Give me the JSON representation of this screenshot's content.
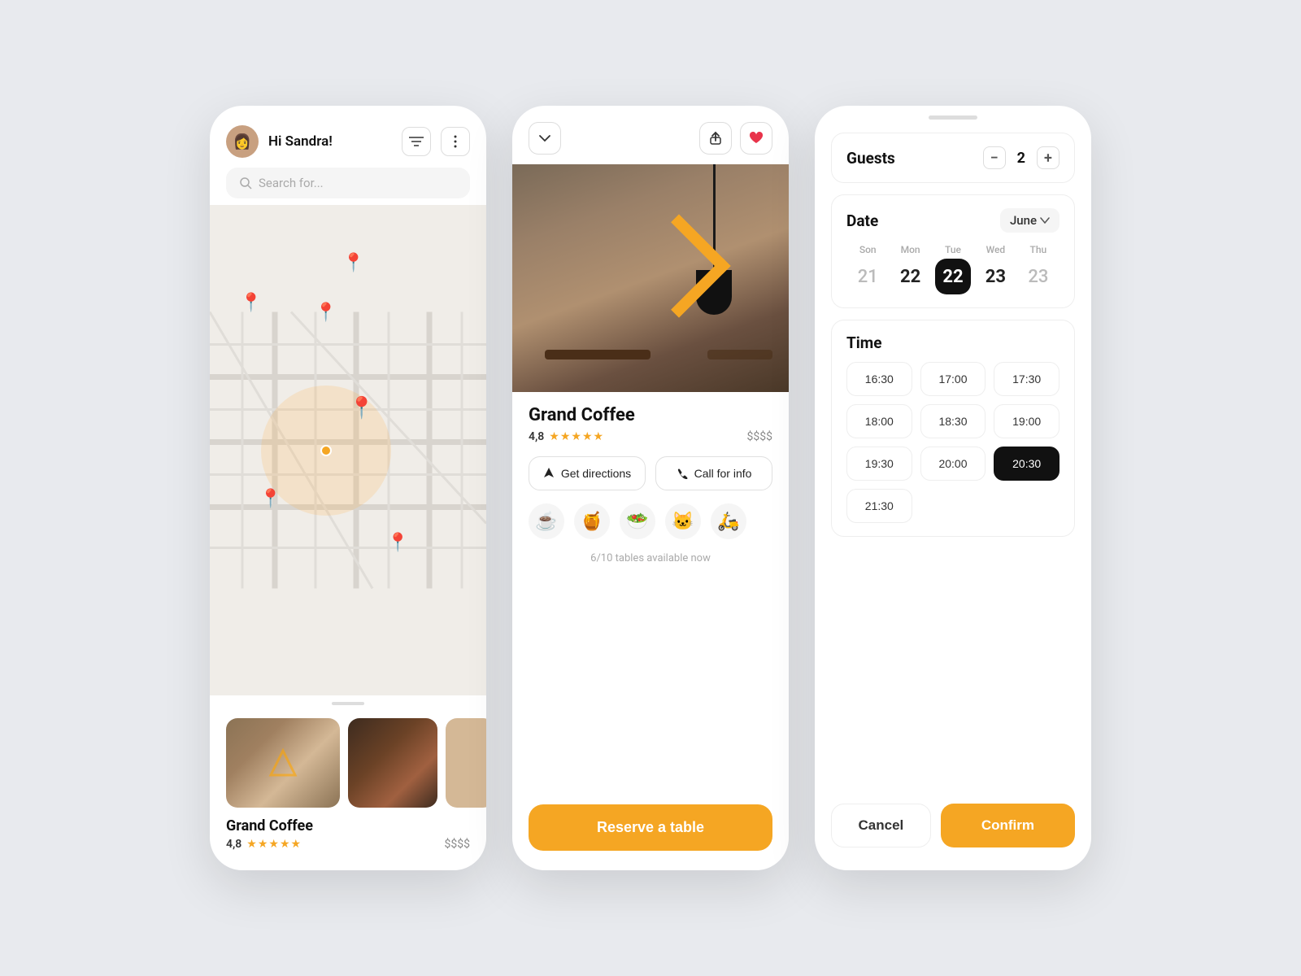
{
  "phone1": {
    "greeting": "Hi Sandra!",
    "search_placeholder": "Search for...",
    "restaurant": {
      "name": "Grand Coffee",
      "rating": "4,8",
      "price": "$$$$"
    }
  },
  "phone2": {
    "restaurant_name": "Grand Coffee",
    "rating": "4,8",
    "price": "$$$$",
    "get_directions": "Get directions",
    "call_for_info": "Call for info",
    "availability": "6/10 tables available now",
    "reserve_btn": "Reserve a table",
    "emojis": [
      "☕",
      "🍯",
      "🥗",
      "🐱",
      "🛵"
    ]
  },
  "phone3": {
    "guests_label": "Guests",
    "guests_count": "2",
    "date_label": "Date",
    "month": "June",
    "days": [
      {
        "name": "Son",
        "num": "21",
        "style": "light"
      },
      {
        "name": "Mon",
        "num": "22",
        "style": "normal"
      },
      {
        "name": "Tue",
        "num": "22",
        "style": "selected"
      },
      {
        "name": "Wed",
        "num": "23",
        "style": "normal"
      },
      {
        "name": "Thu",
        "num": "23",
        "style": "light"
      }
    ],
    "time_label": "Time",
    "times": [
      {
        "val": "16:30",
        "selected": false
      },
      {
        "val": "17:00",
        "selected": false
      },
      {
        "val": "17:30",
        "selected": false
      },
      {
        "val": "18:00",
        "selected": false
      },
      {
        "val": "18:30",
        "selected": false
      },
      {
        "val": "19:00",
        "selected": false
      },
      {
        "val": "19:30",
        "selected": false
      },
      {
        "val": "20:00",
        "selected": false
      },
      {
        "val": "20:30",
        "selected": true
      },
      {
        "val": "21:30",
        "selected": false
      }
    ],
    "cancel_label": "Cancel",
    "confirm_label": "Confirm"
  },
  "icons": {
    "search": "🔍",
    "pin": "📍",
    "filter": "≡",
    "more": "⋮",
    "back": "⌄",
    "share": "↑",
    "heart": "♡",
    "nav": "▲",
    "phone": "📞",
    "minus": "−",
    "plus": "+"
  }
}
